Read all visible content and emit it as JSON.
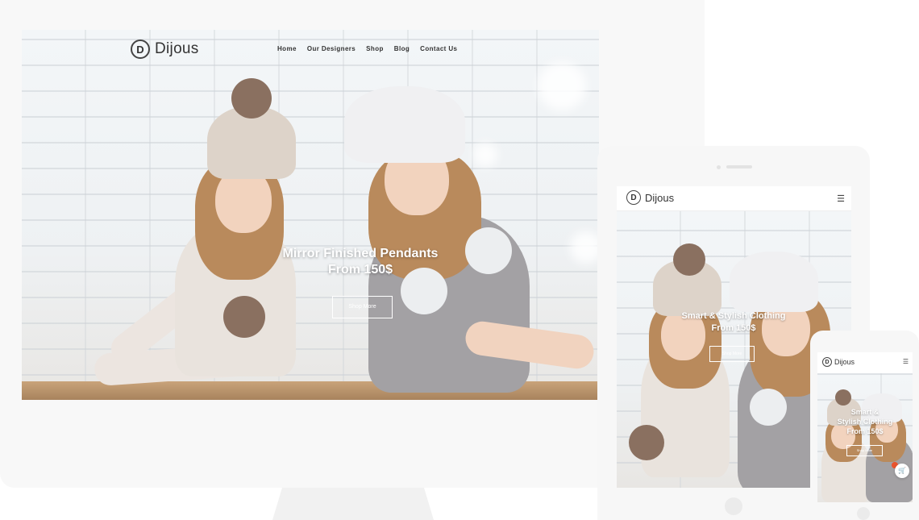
{
  "desktop": {
    "logo_text": "Dijous",
    "logo_mark": "D",
    "nav": [
      "Home",
      "Our Designers",
      "Shop",
      "Blog",
      "Contact Us"
    ],
    "headline_line1": "Mirror Finished Pendants",
    "headline_line2": "From 150$",
    "cta_label": "Shop More"
  },
  "tablet": {
    "logo_text": "Dijous",
    "logo_mark": "D",
    "menu_icon": "☰",
    "headline_line1": "Smart & Stylish Clothing",
    "headline_line2": "From 150$",
    "cta_label": "Shop More"
  },
  "phone": {
    "logo_text": "Dijous",
    "logo_mark": "D",
    "menu_icon": "☰",
    "headline_line1": "Smart &",
    "headline_line2": "Stylish Clothing",
    "headline_line3": "From 150$",
    "cta_label": "Shop More",
    "cart_icon": "🛒"
  },
  "colors": {
    "text_dark": "#333333",
    "accent_badge": "#e8532d",
    "device_frame": "#f7f7f7"
  }
}
